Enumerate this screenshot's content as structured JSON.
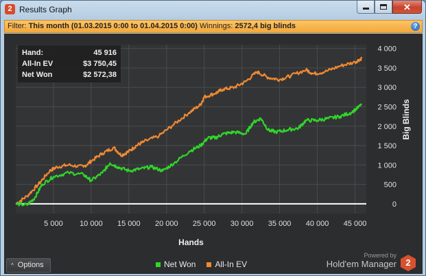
{
  "window": {
    "title": "Results Graph",
    "app_badge": "2"
  },
  "filter": {
    "label": "Filter:",
    "value": "This month (01.03.2015 0:00 to 01.04.2015 0:00)",
    "winnings_label": "Winnings:",
    "winnings_value": "2572,4 big blinds",
    "help_glyph": "?"
  },
  "stats": [
    {
      "label": "Hand:",
      "value": "45 916"
    },
    {
      "label": "All-In EV",
      "value": "$3 750,45"
    },
    {
      "label": "Net Won",
      "value": "$2 572,38"
    }
  ],
  "chart_data": {
    "type": "line",
    "xlabel": "Hands",
    "ylabel": "Big Blinds",
    "x_ticks": [
      5000,
      10000,
      15000,
      20000,
      25000,
      30000,
      35000,
      40000,
      45000
    ],
    "x_tick_labels": [
      "5 000",
      "10 000",
      "15 000",
      "20 000",
      "25 000",
      "30 000",
      "35 000",
      "40 000",
      "45 000"
    ],
    "y_ticks": [
      0,
      500,
      1000,
      1500,
      2000,
      2500,
      3000,
      3500,
      4000
    ],
    "y_tick_labels": [
      "0",
      "500",
      "1 000",
      "1 500",
      "2 000",
      "2 500",
      "3 000",
      "3 500",
      "4 000"
    ],
    "xlim": [
      0,
      46500
    ],
    "ylim": [
      -250,
      4100
    ],
    "grid": true,
    "series": [
      {
        "name": "All-In EV",
        "color": "#f08a32",
        "x": [
          0,
          1500,
          3000,
          4500,
          5500,
          7000,
          9000,
          10000,
          11500,
          13000,
          14000,
          15000,
          16000,
          17000,
          19000,
          21000,
          23000,
          24500,
          25000,
          26500,
          27500,
          29000,
          30500,
          32000,
          33500,
          35000,
          36500,
          38500,
          39500,
          41000,
          43000,
          45000,
          45900
        ],
        "y": [
          0,
          200,
          500,
          850,
          950,
          1000,
          950,
          1100,
          1300,
          1450,
          1250,
          1350,
          1500,
          1600,
          1750,
          2050,
          2350,
          2550,
          2750,
          2850,
          2950,
          3000,
          3150,
          3400,
          3250,
          3200,
          3300,
          3450,
          3350,
          3400,
          3550,
          3650,
          3750
        ]
      },
      {
        "name": "Net Won",
        "color": "#31d629",
        "x": [
          0,
          1500,
          2500,
          3500,
          5000,
          7000,
          9000,
          10000,
          11500,
          12500,
          13500,
          15000,
          16500,
          18000,
          19500,
          21000,
          23000,
          24500,
          25500,
          26500,
          27500,
          29000,
          30500,
          31500,
          32500,
          33500,
          34500,
          36000,
          37500,
          38500,
          40000,
          41500,
          43000,
          44500,
          45900
        ],
        "y": [
          0,
          -30,
          150,
          500,
          700,
          800,
          750,
          600,
          800,
          1050,
          950,
          850,
          900,
          950,
          850,
          1050,
          1350,
          1500,
          1700,
          1700,
          1800,
          1850,
          1800,
          2100,
          2200,
          1900,
          1850,
          1900,
          1950,
          2150,
          2150,
          2200,
          2250,
          2350,
          2550
        ]
      }
    ]
  },
  "options_button": {
    "label": "Options",
    "chevron": "^"
  },
  "legend": [
    {
      "label": "Net Won",
      "color": "#31d629"
    },
    {
      "label": "All-In EV",
      "color": "#f08a32"
    }
  ],
  "brand": {
    "powered_by": "Powered by",
    "name": "Hold'em Manager",
    "logo_glyph": "2"
  }
}
